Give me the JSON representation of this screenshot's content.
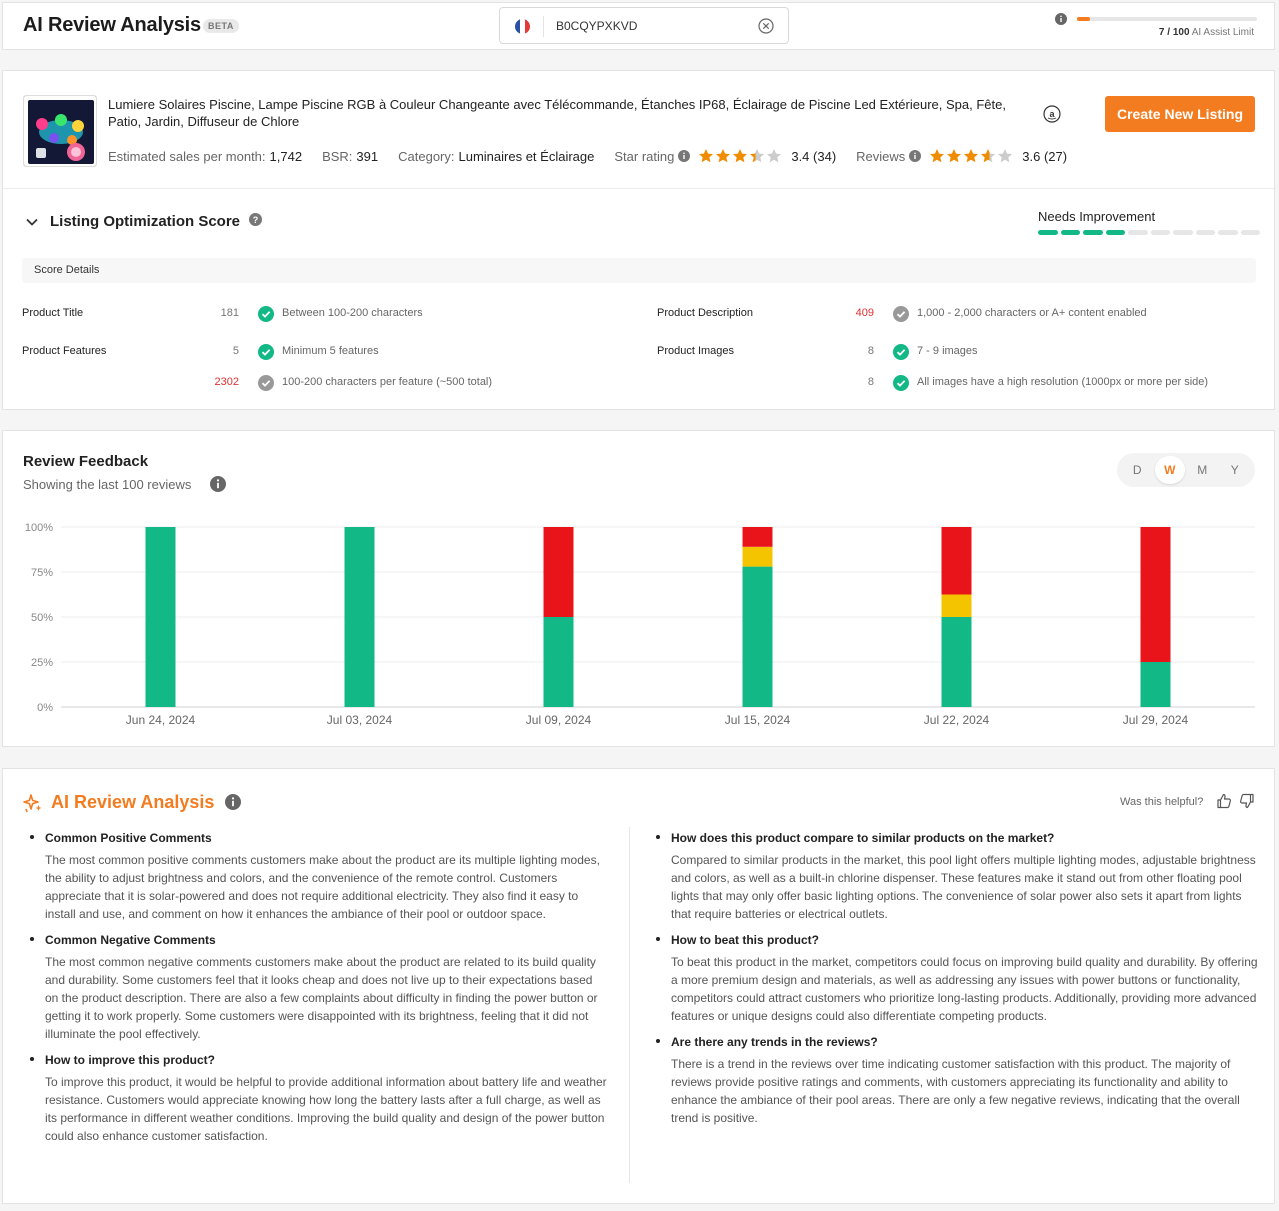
{
  "header": {
    "title": "AI Review Analysis",
    "beta": "BETA",
    "asin": "B0CQYPXKVD",
    "limit": {
      "used": 7,
      "total": 100,
      "label": "7 / 100",
      "suffix": "AI Assist Limit"
    }
  },
  "product": {
    "title": "Lumiere Solaires Piscine, Lampe Piscine RGB à Couleur Changeante avec Télécommande, Étanches IP68, Éclairage de Piscine Led Extérieure, Spa, Fête, Patio, Jardin, Diffuseur de Chlore",
    "create_button": "Create New Listing",
    "sales_label": "Estimated sales per month:",
    "sales_value": "1,742",
    "bsr_label": "BSR:",
    "bsr_value": "391",
    "category_label": "Category:",
    "category_value": "Luminaires et Éclairage",
    "star_label": "Star rating",
    "star_rating": 3.4,
    "star_value": "3.4 (34)",
    "reviews_label": "Reviews",
    "reviews_rating": 3.6,
    "reviews_value": "3.6 (27)"
  },
  "optimization": {
    "title": "Listing Optimization Score",
    "status": "Needs Improvement",
    "score_segments": 4,
    "total_segments": 10,
    "details_label": "Score Details",
    "rows": [
      {
        "label": "Product Title",
        "value": "181",
        "ok": true,
        "text": "Between 100-200 characters"
      },
      {
        "label": "Product Features",
        "value": "5",
        "ok": true,
        "text": "Minimum 5 features"
      },
      {
        "label": "",
        "value": "2302",
        "ok": false,
        "text": "100-200 characters per feature (~500 total)"
      },
      {
        "label": "Product Description",
        "value": "409",
        "ok": false,
        "text": "1,000 - 2,000 characters or A+ content enabled"
      },
      {
        "label": "Product Images",
        "value": "8",
        "ok": true,
        "text": "7 - 9 images"
      },
      {
        "label": "",
        "value": "8",
        "ok": true,
        "text": "All images have a high resolution (1000px or more per side)"
      }
    ]
  },
  "review_feedback": {
    "title": "Review Feedback",
    "subtitle": "Showing the last 100 reviews",
    "periods": [
      "D",
      "W",
      "M",
      "Y"
    ],
    "active_period": "W"
  },
  "chart_data": {
    "type": "bar",
    "stacked": true,
    "categories": [
      "Jun 24, 2024",
      "Jul 03, 2024",
      "Jul 09, 2024",
      "Jul 15, 2024",
      "Jul 22, 2024",
      "Jul 29, 2024"
    ],
    "series": [
      {
        "color": "#12b886",
        "values": [
          100,
          100,
          50,
          78,
          50,
          25
        ]
      },
      {
        "color": "#f5c400",
        "values": [
          0,
          0,
          0,
          11,
          12.5,
          0
        ]
      },
      {
        "color": "#e8141a",
        "values": [
          0,
          0,
          50,
          11,
          37.5,
          75
        ]
      }
    ],
    "ylim": [
      0,
      100
    ],
    "yticks": [
      "0%",
      "25%",
      "50%",
      "75%",
      "100%"
    ],
    "grid": true
  },
  "ai_analysis": {
    "title": "AI Review Analysis",
    "helpful_label": "Was this helpful?",
    "left": [
      {
        "heading": "Common Positive Comments",
        "body": "The most common positive comments customers make about the product are its multiple lighting modes, the ability to adjust brightness and colors, and the convenience of the remote control. Customers appreciate that it is solar-powered and does not require additional electricity. They also find it easy to install and use, and comment on how it enhances the ambiance of their pool or outdoor space."
      },
      {
        "heading": "Common Negative Comments",
        "body": "The most common negative comments customers make about the product are related to its build quality and durability. Some customers feel that it looks cheap and does not live up to their expectations based on the product description. There are also a few complaints about difficulty in finding the power button or getting it to work properly. Some customers were disappointed with its brightness, feeling that it did not illuminate the pool effectively."
      },
      {
        "heading": "How to improve this product?",
        "body": "To improve this product, it would be helpful to provide additional information about battery life and weather resistance. Customers would appreciate knowing how long the battery lasts after a full charge, as well as its performance in different weather conditions. Improving the build quality and design of the power button could also enhance customer satisfaction."
      }
    ],
    "right": [
      {
        "heading": "How does this product compare to similar products on the market?",
        "body": "Compared to similar products in the market, this pool light offers multiple lighting modes, adjustable brightness and colors, as well as a built-in chlorine dispenser. These features make it stand out from other floating pool lights that may only offer basic lighting options. The convenience of solar power also sets it apart from lights that require batteries or electrical outlets."
      },
      {
        "heading": "How to beat this product?",
        "body": "To beat this product in the market, competitors could focus on improving build quality and durability. By offering a more premium design and materials, as well as addressing any issues with power buttons or functionality, competitors could attract customers who prioritize long-lasting products. Additionally, providing more advanced features or unique designs could also differentiate competing products."
      },
      {
        "heading": "Are there any trends in the reviews?",
        "body": "There is a trend in the reviews over time indicating customer satisfaction with this product. The majority of reviews provide positive ratings and comments, with customers appreciating its functionality and ability to enhance the ambiance of their pool areas. There are only a few negative reviews, indicating that the overall trend is positive."
      }
    ]
  },
  "colors": {
    "accent": "#f47c20",
    "positive": "#12b886",
    "neutral": "#f5c400",
    "negative": "#e8141a",
    "error_text": "#e03131"
  }
}
